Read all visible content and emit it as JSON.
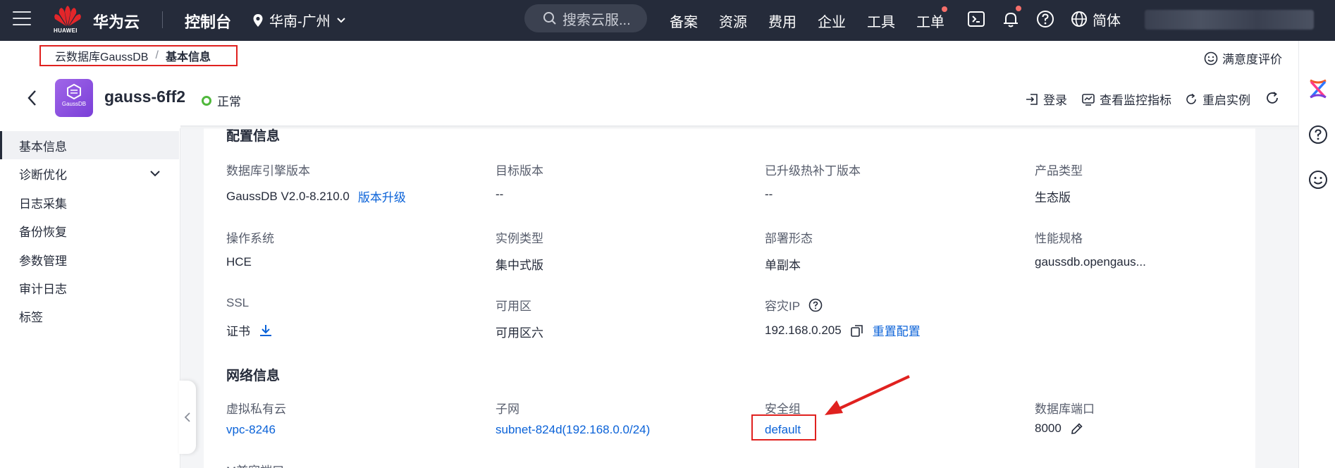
{
  "topnav": {
    "logo_text": "HUAWEI",
    "brand": "华为云",
    "console": "控制台",
    "region": "华南-广州",
    "search_placeholder": "搜索云服...",
    "links": [
      "备案",
      "资源",
      "费用",
      "企业",
      "工具",
      "工单"
    ],
    "language": "简体"
  },
  "breadcrumb": {
    "parent": "云数据库GaussDB",
    "separator": "/",
    "current": "基本信息"
  },
  "rating": "满意度评价",
  "instance": {
    "icon_text": "GaussDB",
    "name": "gauss-6ff2",
    "status": "正常"
  },
  "actions": {
    "login": "登录",
    "monitor": "查看监控指标",
    "restart": "重启实例"
  },
  "sidebar": {
    "items": [
      {
        "label": "基本信息"
      },
      {
        "label": "诊断优化"
      },
      {
        "label": "日志采集"
      },
      {
        "label": "备份恢复"
      },
      {
        "label": "参数管理"
      },
      {
        "label": "审计日志"
      },
      {
        "label": "标签"
      }
    ]
  },
  "config": {
    "title": "配置信息",
    "engine_version_label": "数据库引擎版本",
    "engine_version": "GaussDB V2.0-8.210.0",
    "upgrade_link": "版本升级",
    "target_version_label": "目标版本",
    "target_version": "--",
    "hotfix_label": "已升级热补丁版本",
    "hotfix": "--",
    "product_type_label": "产品类型",
    "product_type": "生态版",
    "os_label": "操作系统",
    "os": "HCE",
    "instance_type_label": "实例类型",
    "instance_type": "集中式版",
    "deploy_label": "部署形态",
    "deploy": "单副本",
    "spec_label": "性能规格",
    "spec": "gaussdb.opengaus...",
    "ssl_label": "SSL",
    "ssl": "证书",
    "az_label": "可用区",
    "az": "可用区六",
    "dr_ip_label": "容灾IP",
    "dr_ip": "192.168.0.205",
    "reset_link": "重置配置"
  },
  "network": {
    "title": "网络信息",
    "vpc_label": "虚拟私有云",
    "vpc": "vpc-8246",
    "subnet_label": "子网",
    "subnet": "subnet-824d(192.168.0.0/24)",
    "sg_label": "安全组",
    "sg": "default",
    "port_label": "数据库端口",
    "port": "8000",
    "compat_port_label": "M兼容端口"
  }
}
